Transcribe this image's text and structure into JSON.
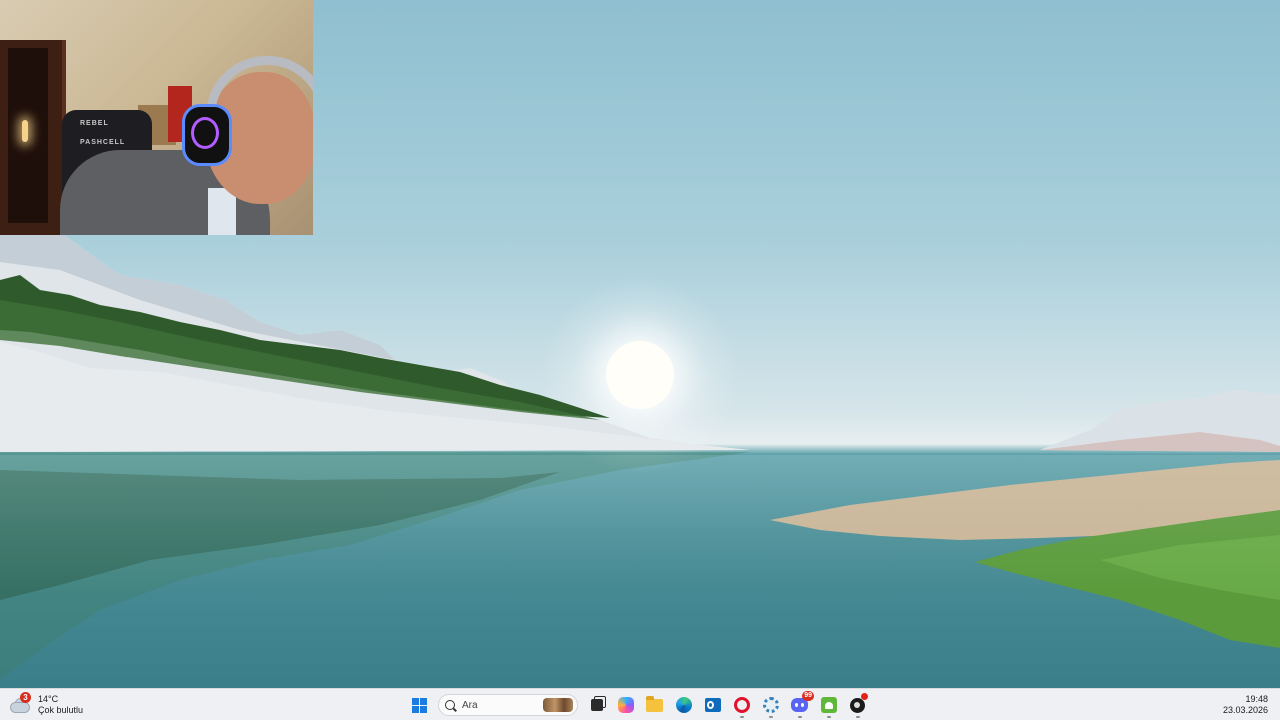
{
  "desktop": {
    "wallpaper": "windows-11-lake-landscape",
    "webcam_overlay": {
      "chair_brand_text": "REBEL",
      "chair_text_2": "PASHCELL"
    }
  },
  "taskbar": {
    "weather": {
      "temperature": "14°C",
      "condition": "Çok bulutlu",
      "badge_count": "3",
      "icon": "cloud-icon"
    },
    "search": {
      "placeholder": "Ara"
    },
    "apps": [
      {
        "name": "task-view",
        "icon": "task-view-icon"
      },
      {
        "name": "copilot",
        "icon": "copilot-icon"
      },
      {
        "name": "file-explorer",
        "icon": "folder-icon"
      },
      {
        "name": "edge",
        "icon": "edge-icon"
      },
      {
        "name": "outlook",
        "icon": "outlook-icon"
      },
      {
        "name": "opera",
        "icon": "opera-icon"
      },
      {
        "name": "settings",
        "icon": "gear-icon"
      },
      {
        "name": "discord",
        "icon": "discord-icon",
        "badge": "99"
      },
      {
        "name": "android",
        "icon": "android-icon"
      },
      {
        "name": "pinned-app",
        "icon": "ball-icon"
      }
    ],
    "clock": {
      "time": "19:48",
      "date": "23.03.2026"
    },
    "colors": {
      "accent": "#1a7be0",
      "badge": "#d92d20"
    }
  }
}
